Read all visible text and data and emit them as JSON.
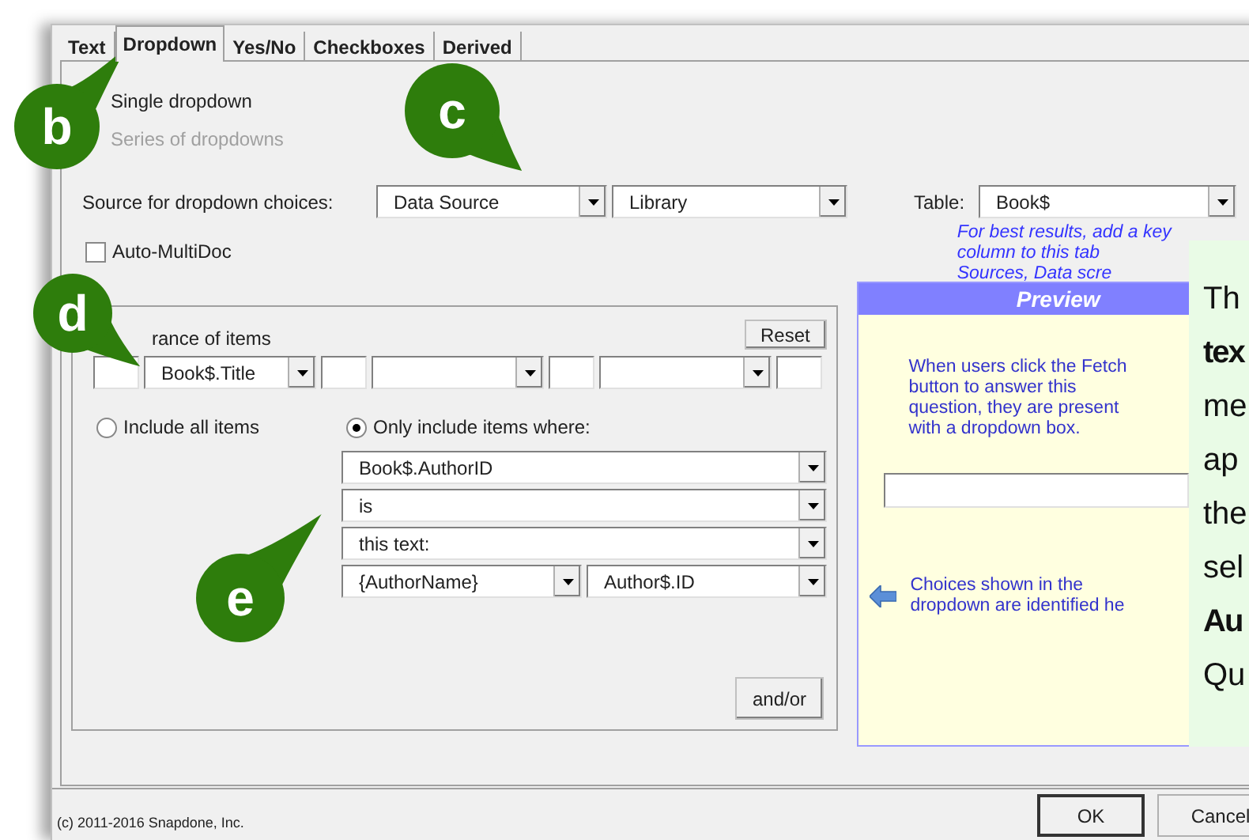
{
  "tabs": [
    {
      "label": "Text",
      "selected": false
    },
    {
      "label": "Dropdown",
      "selected": true
    },
    {
      "label": "Yes/No",
      "selected": false
    },
    {
      "label": "Checkboxes",
      "selected": false
    },
    {
      "label": "Derived",
      "selected": false
    }
  ],
  "dropdown_types": [
    {
      "label": "Single dropdown",
      "disabled": false
    },
    {
      "label": "Series of dropdowns",
      "disabled": true
    }
  ],
  "source": {
    "label": "Source for dropdown choices:",
    "source_type": "Data Source",
    "data_source": "Library",
    "table_label": "Table:",
    "table": "Book$",
    "hint_lines": [
      "For best results, add a key",
      "column to this tab",
      "Sources, Data scre"
    ]
  },
  "auto_multidoc": {
    "label": "Auto-MultiDoc",
    "checked": false
  },
  "appearance": {
    "label": "rance of items",
    "reset": "Reset",
    "fields": [
      {
        "kind": "text"
      },
      {
        "kind": "dropdown",
        "value": "Book$.Title"
      },
      {
        "kind": "text"
      },
      {
        "kind": "dropdown"
      },
      {
        "kind": "text"
      },
      {
        "kind": "dropdown"
      },
      {
        "kind": "text"
      }
    ]
  },
  "filter": {
    "options": [
      {
        "label": "Include all items",
        "selected": false
      },
      {
        "label": "Only include items where:",
        "selected": true
      }
    ],
    "conditions": [
      [
        "Book$.AuthorID"
      ],
      [
        "is"
      ],
      [
        "this text:"
      ],
      [
        "{AuthorName}",
        "Author$.ID"
      ]
    ],
    "and_or": "and/or"
  },
  "preview": {
    "title": "Preview",
    "intro_lines": [
      "When users click the Fetch",
      "button to answer this",
      "question, they are present",
      "with a dropdown box."
    ],
    "choices_lines": [
      "Choices shown in the",
      "dropdown are identified he"
    ]
  },
  "note": {
    "lines": [
      {
        "text": "Th",
        "bold": false
      },
      {
        "text": "tex",
        "bold": true
      },
      {
        "text": "me",
        "bold": false
      },
      {
        "text": "ap",
        "bold": false
      },
      {
        "text": "the",
        "bold": false
      },
      {
        "text": "sel",
        "bold": false
      },
      {
        "text": "Au",
        "bold": true
      },
      {
        "text": "Qu",
        "bold": false
      }
    ]
  },
  "callouts": [
    {
      "letter": "b"
    },
    {
      "letter": "c"
    },
    {
      "letter": "d"
    },
    {
      "letter": "e"
    }
  ],
  "footer": {
    "copyright": "(c) 2011-2016 Snapdone, Inc.",
    "buttons": [
      "OK",
      "Cancel"
    ]
  }
}
